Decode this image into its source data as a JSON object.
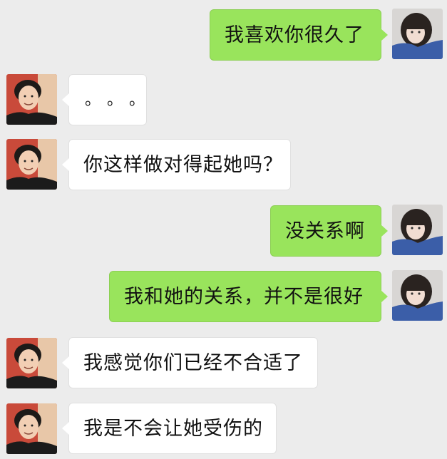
{
  "messages": [
    {
      "side": "right",
      "sender": "girl",
      "text": "我喜欢你很久了"
    },
    {
      "side": "left",
      "sender": "boy",
      "text": "。。。"
    },
    {
      "side": "left",
      "sender": "boy",
      "text": "你这样做对得起她吗？"
    },
    {
      "side": "right",
      "sender": "girl",
      "text": "没关系啊"
    },
    {
      "side": "right",
      "sender": "girl",
      "text": "我和她的关系，并不是很好"
    },
    {
      "side": "left",
      "sender": "boy",
      "text": "我感觉你们已经不合适了"
    },
    {
      "side": "left",
      "sender": "boy",
      "text": "我是不会让她受伤的"
    }
  ],
  "theme": {
    "background": "#ececec",
    "outgoing_bubble": "#99e45c",
    "incoming_bubble": "#ffffff"
  }
}
